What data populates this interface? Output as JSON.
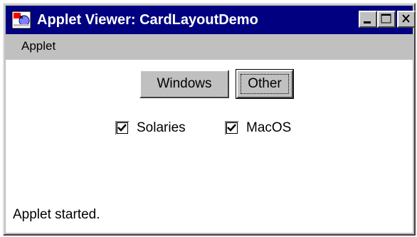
{
  "window": {
    "title": "Applet Viewer: CardLayoutDemo",
    "titlebar_color": "#000080",
    "controls": [
      "minimize-icon",
      "maximize-icon",
      "close-icon"
    ]
  },
  "menubar": {
    "items": [
      {
        "label": "Applet"
      }
    ]
  },
  "main": {
    "buttons": [
      {
        "label": "Windows"
      },
      {
        "label": "Other"
      }
    ],
    "checkboxes": [
      {
        "label": "Solaries",
        "checked": true
      },
      {
        "label": "MacOS",
        "checked": true
      }
    ]
  },
  "status": {
    "text": "Applet started."
  }
}
